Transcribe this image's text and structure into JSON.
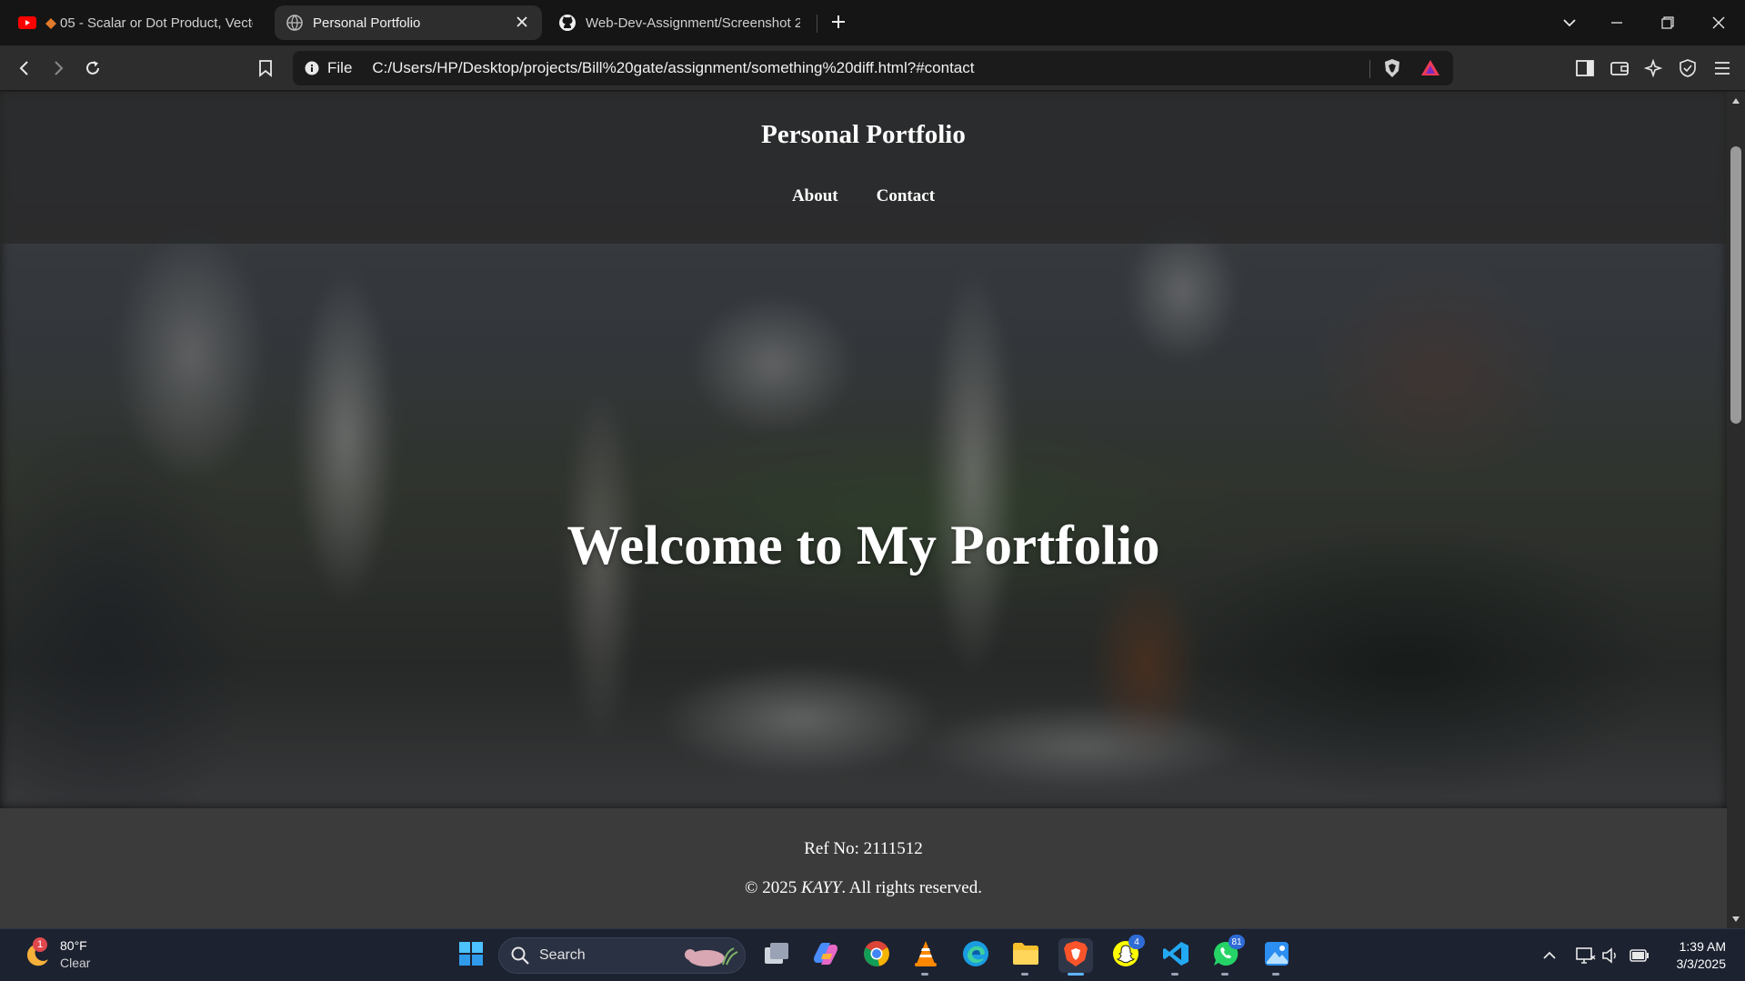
{
  "browser": {
    "tabs": [
      {
        "title": "05 - Scalar or Dot Product, Vecto",
        "favicon": "youtube-icon",
        "active": false
      },
      {
        "title": "Personal Portfolio",
        "favicon": "globe-icon",
        "active": true
      },
      {
        "title": "Web-Dev-Assignment/Screenshot 2",
        "favicon": "github-icon",
        "active": false
      }
    ],
    "address": {
      "scheme_label": "File",
      "url": "C:/Users/HP/Desktop/projects/Bill%20gate/assignment/something%20diff.html?#contact"
    }
  },
  "page": {
    "site_title": "Personal Portfolio",
    "nav": [
      {
        "label": "About"
      },
      {
        "label": "Contact"
      }
    ],
    "hero_title": "Welcome to My Portfolio",
    "footer": {
      "ref": "Ref No: 2111512",
      "copyright_prefix": "© 2025 ",
      "copyright_name": "KAYY",
      "copyright_suffix": ". All rights reserved."
    }
  },
  "taskbar": {
    "weather": {
      "temp": "80°F",
      "condition": "Clear",
      "badge": "1"
    },
    "search_label": "Search",
    "badges": {
      "snapchat": "4",
      "whatsapp": "81"
    },
    "clock": {
      "time": "1:39 AM",
      "date": "3/3/2025"
    }
  },
  "colors": {
    "accent_active_tab": "#2d2d2d",
    "taskbar": "#1c2230",
    "footer": "#3b3b3b"
  }
}
